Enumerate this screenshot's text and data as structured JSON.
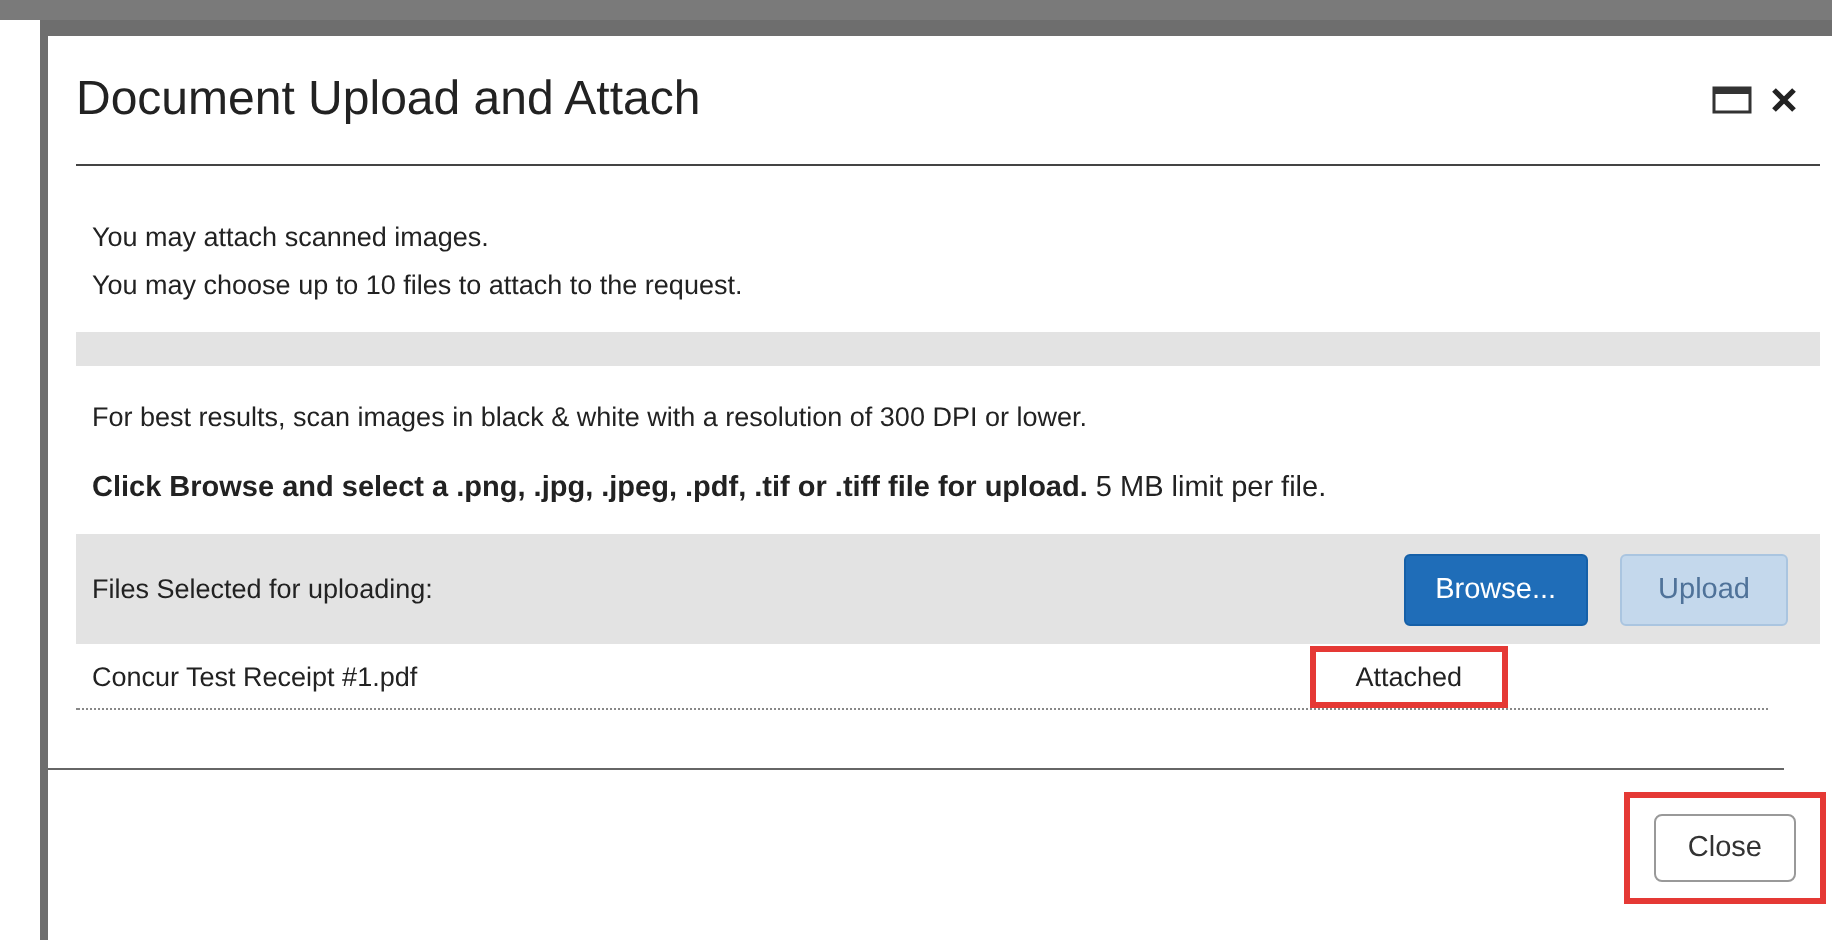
{
  "dialog": {
    "title": "Document Upload and Attach",
    "info_lines": [
      "You may attach scanned images.",
      "You may choose up to 10 files to attach to the request."
    ],
    "tip": "For best results, scan images in black & white with a resolution of 300 DPI or lower.",
    "instruction": "**Click Browse and select a .png, .jpg, .jpeg, .pdf, .tif or .tiff file for upload.** 5 MB limit per file.",
    "files_header": {
      "label": "Files Selected for uploading:",
      "buttons": [
        {
          "label": "Browse...",
          "kind": "primary",
          "disabled": false
        },
        {
          "label": "Upload",
          "kind": "primary",
          "disabled": true
        }
      ]
    },
    "files": [
      {
        "name": "Concur Test Receipt #1.pdf",
        "status": "Attached",
        "highlighted": true
      }
    ],
    "footer_buttons": [
      {
        "label": "Close",
        "highlighted": true
      }
    ]
  }
}
